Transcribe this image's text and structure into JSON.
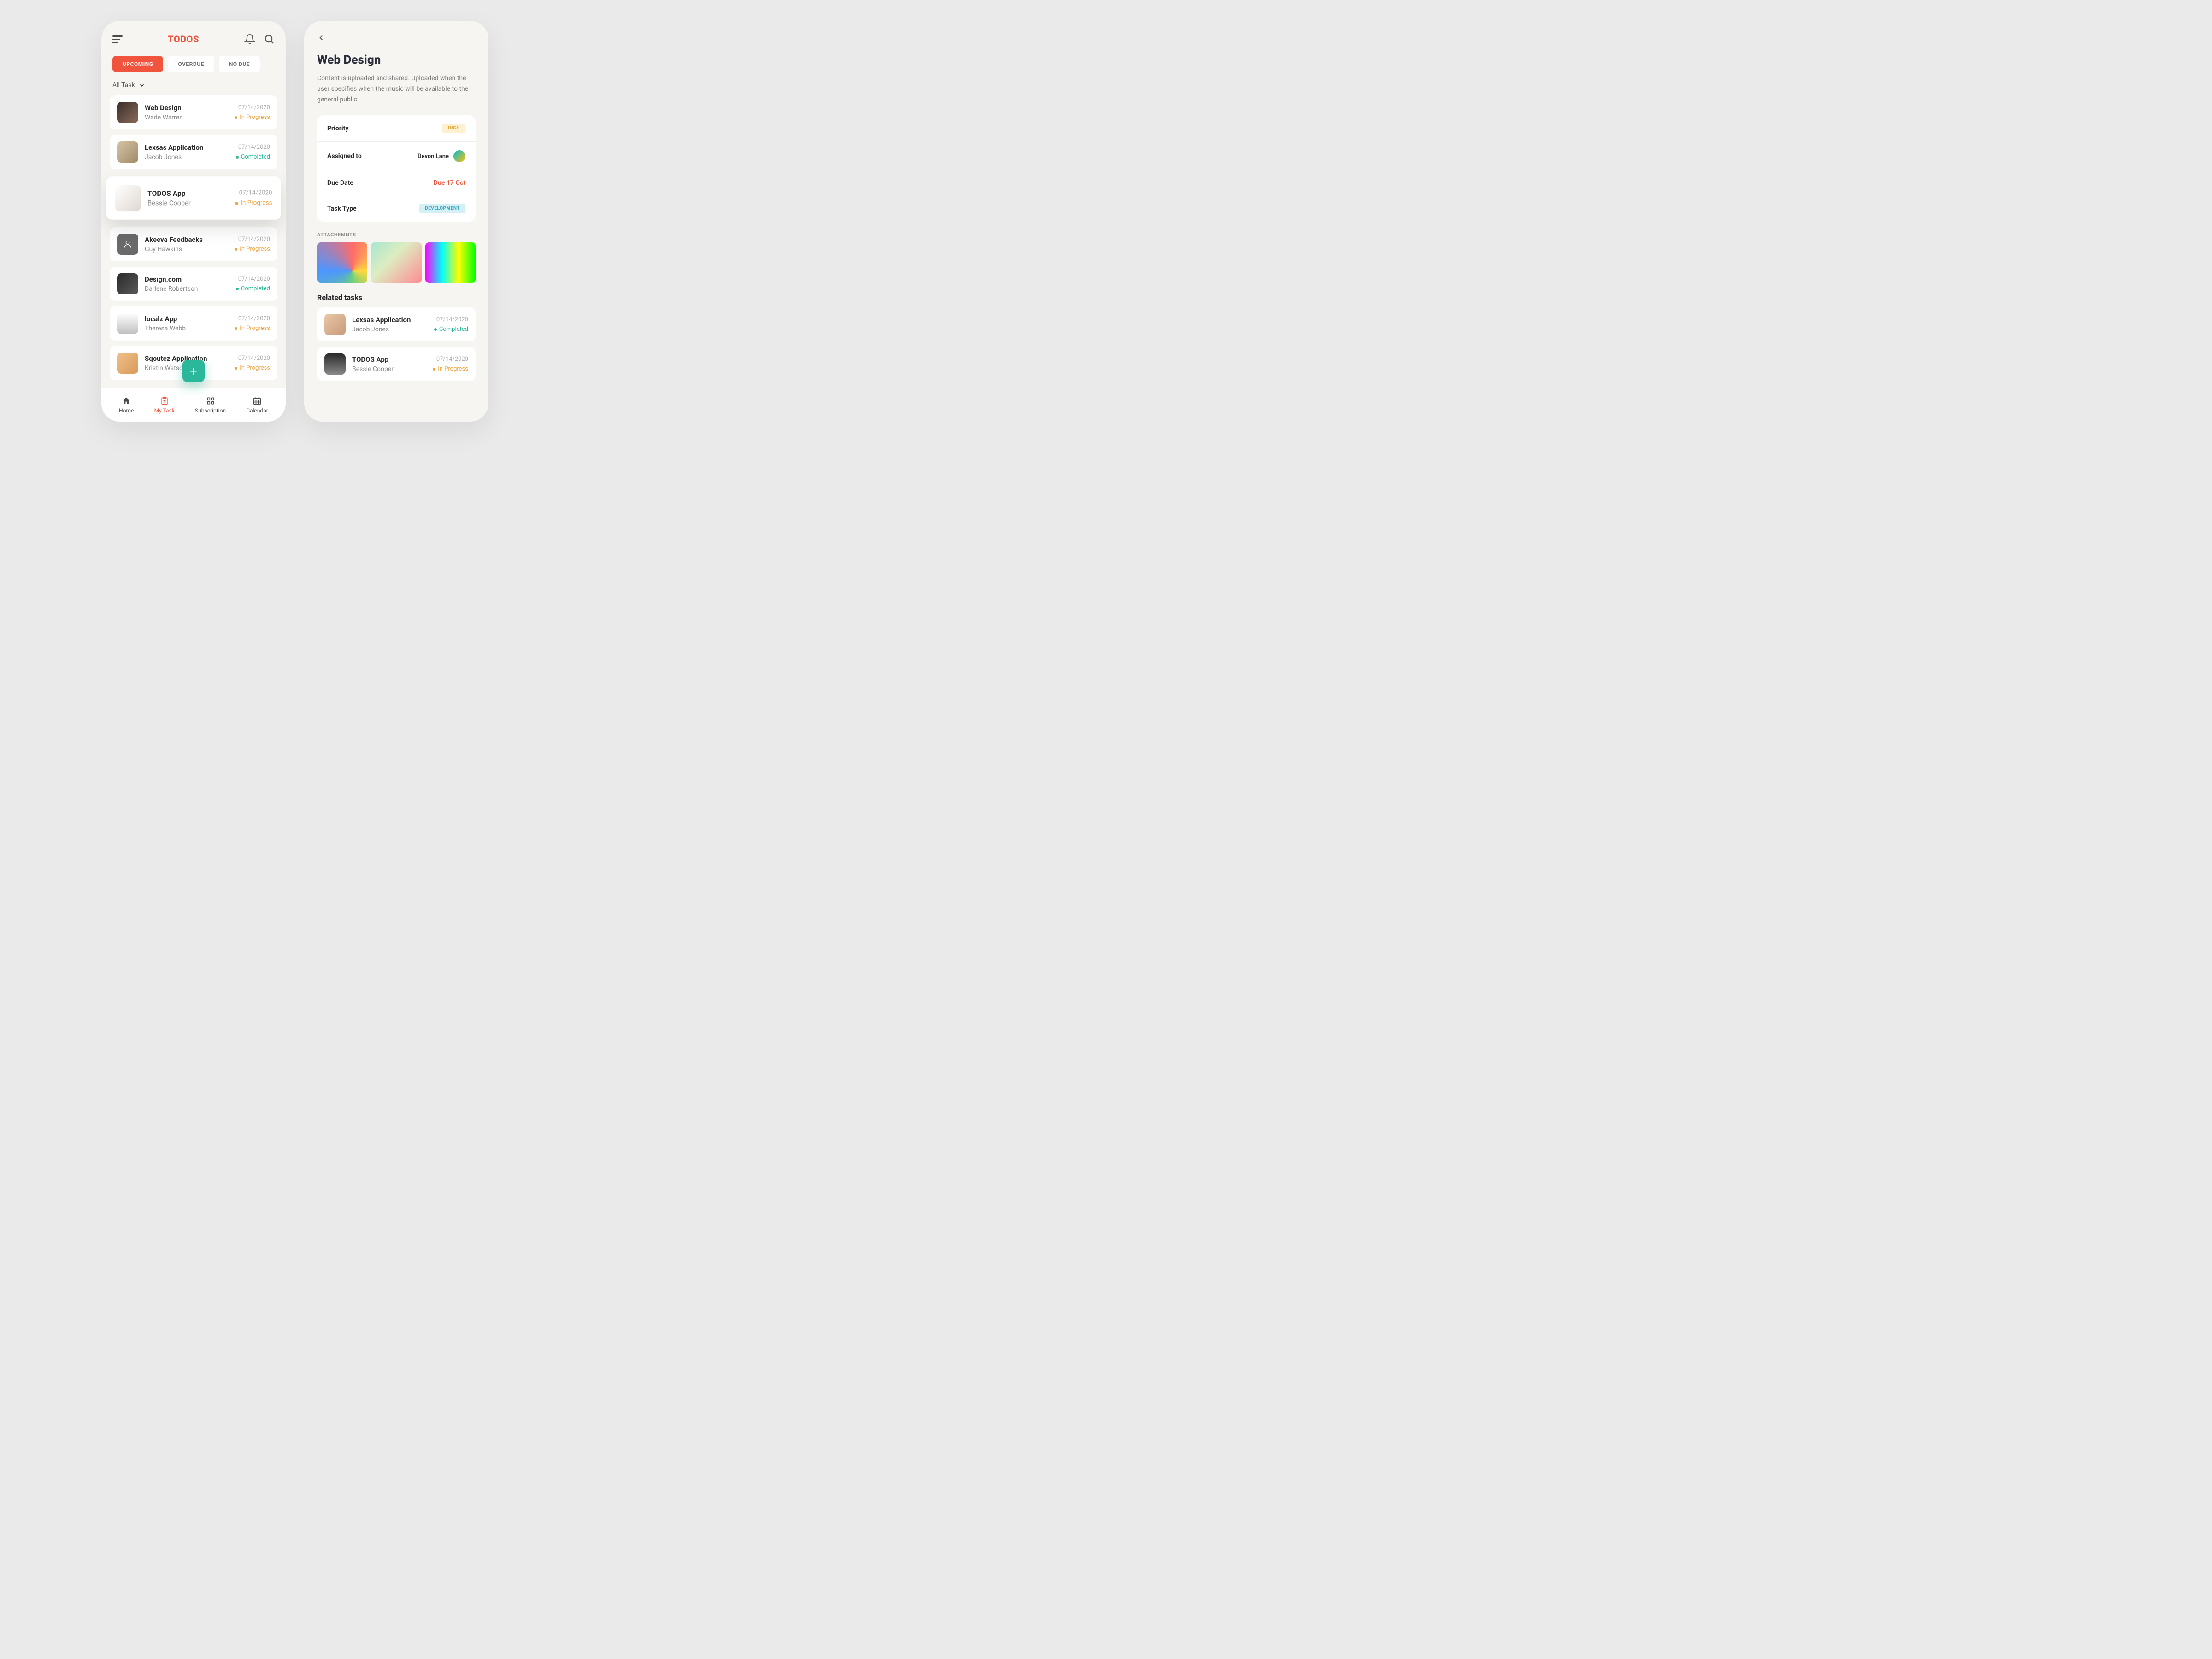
{
  "app": {
    "title": "TODOS"
  },
  "tabs": {
    "upcoming": "UPCOMING",
    "overdue": "OVERDUE",
    "nodue": "NO DUE"
  },
  "filter": {
    "label": "All Task"
  },
  "tasks": [
    {
      "title": "Web Design",
      "author": "Wade Warren",
      "date": "07/14/2020",
      "status": "In Progress",
      "state": "progress"
    },
    {
      "title": "Lexsas Application",
      "author": "Jacob Jones",
      "date": "07/14/2020",
      "status": "Completed",
      "state": "done"
    },
    {
      "title": "TODOS App",
      "author": "Bessie Cooper",
      "date": "07/14/2020",
      "status": "In Progress",
      "state": "progress"
    },
    {
      "title": "Akeeva Feedbacks",
      "author": "Guy Hawkins",
      "date": "07/14/2020",
      "status": "In Progress",
      "state": "progress"
    },
    {
      "title": "Design.com",
      "author": "Darlene Robertson",
      "date": "07/14/2020",
      "status": "Completed",
      "state": "done"
    },
    {
      "title": "localz App",
      "author": "Theresa Webb",
      "date": "07/14/2020",
      "status": "In Progress",
      "state": "progress"
    },
    {
      "title": "Sqoutez Application",
      "author": "Kristin Watson",
      "date": "07/14/2020",
      "status": "In Progress",
      "state": "progress"
    }
  ],
  "nav": {
    "home": "Home",
    "mytask": "My Task",
    "subscription": "Subscription",
    "calendar": "Calendar"
  },
  "detail": {
    "title": "Web Design",
    "desc": "Content is uploaded and shared. Uploaded when the user specifies when the music will be available to the general public",
    "priority_label": "Priority",
    "priority_value": "HIGH",
    "assigned_label": "Assigned to",
    "assigned_value": "Devon Lane",
    "due_label": "Due Date",
    "due_value": "Due 17 Oct",
    "type_label": "Task Type",
    "type_value": "DEVELOPMENT",
    "attachments_label": "ATTACHEMNTS",
    "related_label": "Related tasks"
  },
  "related": [
    {
      "title": "Lexsas Application",
      "author": "Jacob Jones",
      "date": "07/14/2020",
      "status": "Completed",
      "state": "done"
    },
    {
      "title": "TODOS App",
      "author": "Bessie Cooper",
      "date": "07/14/2020",
      "status": "In Progress",
      "state": "progress"
    }
  ]
}
